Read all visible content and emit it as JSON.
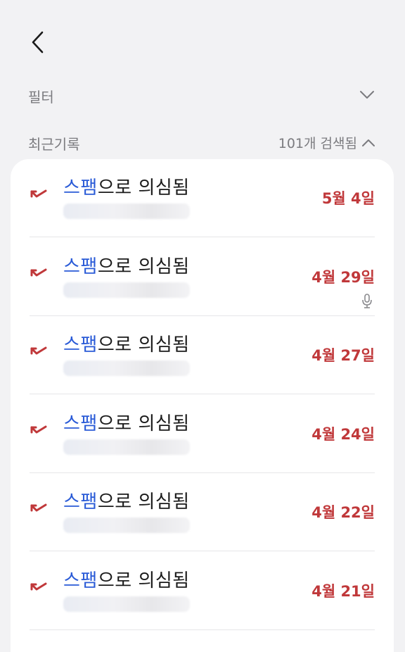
{
  "header": {
    "back_icon": "chevron-left-icon"
  },
  "filter": {
    "label": "필터",
    "icon": "chevron-down-icon"
  },
  "recent": {
    "label": "최근기록",
    "count_text": "101개 검색됨",
    "icon": "chevron-up-icon"
  },
  "colors": {
    "spam_blue": "#2a5bd7",
    "missed_red": "#c0383a",
    "background": "#f2f2f4",
    "card": "#ffffff"
  },
  "calls": [
    {
      "title_highlight": "스팸",
      "title_rest": "으로 의심됨",
      "date": "5월 4일",
      "has_mic": false,
      "icon": "missed-call-icon"
    },
    {
      "title_highlight": "스팸",
      "title_rest": "으로 의심됨",
      "date": "4월 29일",
      "has_mic": true,
      "icon": "missed-call-icon"
    },
    {
      "title_highlight": "스팸",
      "title_rest": "으로 의심됨",
      "date": "4월 27일",
      "has_mic": false,
      "icon": "missed-call-icon"
    },
    {
      "title_highlight": "스팸",
      "title_rest": "으로 의심됨",
      "date": "4월 24일",
      "has_mic": false,
      "icon": "missed-call-icon"
    },
    {
      "title_highlight": "스팸",
      "title_rest": "으로 의심됨",
      "date": "4월 22일",
      "has_mic": false,
      "icon": "missed-call-icon"
    },
    {
      "title_highlight": "스팸",
      "title_rest": "으로 의심됨",
      "date": "4월 21일",
      "has_mic": false,
      "icon": "missed-call-icon"
    }
  ]
}
